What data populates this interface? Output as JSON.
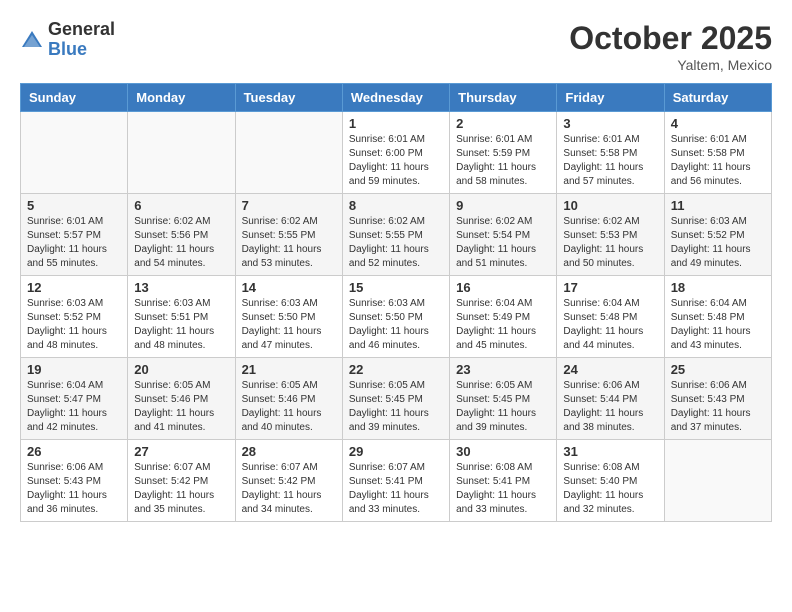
{
  "header": {
    "logo_general": "General",
    "logo_blue": "Blue",
    "month_title": "October 2025",
    "location": "Yaltem, Mexico"
  },
  "days_of_week": [
    "Sunday",
    "Monday",
    "Tuesday",
    "Wednesday",
    "Thursday",
    "Friday",
    "Saturday"
  ],
  "weeks": [
    [
      {
        "day": "",
        "content": ""
      },
      {
        "day": "",
        "content": ""
      },
      {
        "day": "",
        "content": ""
      },
      {
        "day": "1",
        "content": "Sunrise: 6:01 AM\nSunset: 6:00 PM\nDaylight: 11 hours\nand 59 minutes."
      },
      {
        "day": "2",
        "content": "Sunrise: 6:01 AM\nSunset: 5:59 PM\nDaylight: 11 hours\nand 58 minutes."
      },
      {
        "day": "3",
        "content": "Sunrise: 6:01 AM\nSunset: 5:58 PM\nDaylight: 11 hours\nand 57 minutes."
      },
      {
        "day": "4",
        "content": "Sunrise: 6:01 AM\nSunset: 5:58 PM\nDaylight: 11 hours\nand 56 minutes."
      }
    ],
    [
      {
        "day": "5",
        "content": "Sunrise: 6:01 AM\nSunset: 5:57 PM\nDaylight: 11 hours\nand 55 minutes."
      },
      {
        "day": "6",
        "content": "Sunrise: 6:02 AM\nSunset: 5:56 PM\nDaylight: 11 hours\nand 54 minutes."
      },
      {
        "day": "7",
        "content": "Sunrise: 6:02 AM\nSunset: 5:55 PM\nDaylight: 11 hours\nand 53 minutes."
      },
      {
        "day": "8",
        "content": "Sunrise: 6:02 AM\nSunset: 5:55 PM\nDaylight: 11 hours\nand 52 minutes."
      },
      {
        "day": "9",
        "content": "Sunrise: 6:02 AM\nSunset: 5:54 PM\nDaylight: 11 hours\nand 51 minutes."
      },
      {
        "day": "10",
        "content": "Sunrise: 6:02 AM\nSunset: 5:53 PM\nDaylight: 11 hours\nand 50 minutes."
      },
      {
        "day": "11",
        "content": "Sunrise: 6:03 AM\nSunset: 5:52 PM\nDaylight: 11 hours\nand 49 minutes."
      }
    ],
    [
      {
        "day": "12",
        "content": "Sunrise: 6:03 AM\nSunset: 5:52 PM\nDaylight: 11 hours\nand 48 minutes."
      },
      {
        "day": "13",
        "content": "Sunrise: 6:03 AM\nSunset: 5:51 PM\nDaylight: 11 hours\nand 48 minutes."
      },
      {
        "day": "14",
        "content": "Sunrise: 6:03 AM\nSunset: 5:50 PM\nDaylight: 11 hours\nand 47 minutes."
      },
      {
        "day": "15",
        "content": "Sunrise: 6:03 AM\nSunset: 5:50 PM\nDaylight: 11 hours\nand 46 minutes."
      },
      {
        "day": "16",
        "content": "Sunrise: 6:04 AM\nSunset: 5:49 PM\nDaylight: 11 hours\nand 45 minutes."
      },
      {
        "day": "17",
        "content": "Sunrise: 6:04 AM\nSunset: 5:48 PM\nDaylight: 11 hours\nand 44 minutes."
      },
      {
        "day": "18",
        "content": "Sunrise: 6:04 AM\nSunset: 5:48 PM\nDaylight: 11 hours\nand 43 minutes."
      }
    ],
    [
      {
        "day": "19",
        "content": "Sunrise: 6:04 AM\nSunset: 5:47 PM\nDaylight: 11 hours\nand 42 minutes."
      },
      {
        "day": "20",
        "content": "Sunrise: 6:05 AM\nSunset: 5:46 PM\nDaylight: 11 hours\nand 41 minutes."
      },
      {
        "day": "21",
        "content": "Sunrise: 6:05 AM\nSunset: 5:46 PM\nDaylight: 11 hours\nand 40 minutes."
      },
      {
        "day": "22",
        "content": "Sunrise: 6:05 AM\nSunset: 5:45 PM\nDaylight: 11 hours\nand 39 minutes."
      },
      {
        "day": "23",
        "content": "Sunrise: 6:05 AM\nSunset: 5:45 PM\nDaylight: 11 hours\nand 39 minutes."
      },
      {
        "day": "24",
        "content": "Sunrise: 6:06 AM\nSunset: 5:44 PM\nDaylight: 11 hours\nand 38 minutes."
      },
      {
        "day": "25",
        "content": "Sunrise: 6:06 AM\nSunset: 5:43 PM\nDaylight: 11 hours\nand 37 minutes."
      }
    ],
    [
      {
        "day": "26",
        "content": "Sunrise: 6:06 AM\nSunset: 5:43 PM\nDaylight: 11 hours\nand 36 minutes."
      },
      {
        "day": "27",
        "content": "Sunrise: 6:07 AM\nSunset: 5:42 PM\nDaylight: 11 hours\nand 35 minutes."
      },
      {
        "day": "28",
        "content": "Sunrise: 6:07 AM\nSunset: 5:42 PM\nDaylight: 11 hours\nand 34 minutes."
      },
      {
        "day": "29",
        "content": "Sunrise: 6:07 AM\nSunset: 5:41 PM\nDaylight: 11 hours\nand 33 minutes."
      },
      {
        "day": "30",
        "content": "Sunrise: 6:08 AM\nSunset: 5:41 PM\nDaylight: 11 hours\nand 33 minutes."
      },
      {
        "day": "31",
        "content": "Sunrise: 6:08 AM\nSunset: 5:40 PM\nDaylight: 11 hours\nand 32 minutes."
      },
      {
        "day": "",
        "content": ""
      }
    ]
  ]
}
